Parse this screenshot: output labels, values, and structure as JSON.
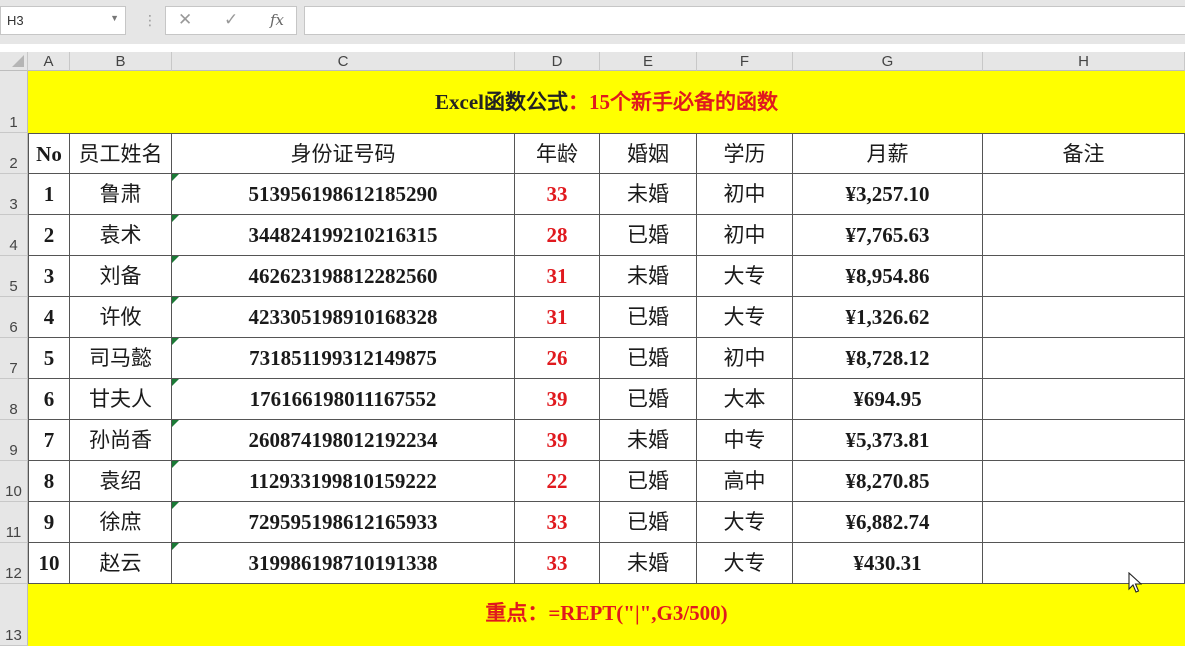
{
  "namebox": {
    "value": "H3"
  },
  "formula_bar": {
    "cancel_icon": "✕",
    "enter_icon": "✓",
    "fx_label": "fx",
    "value": ""
  },
  "columns": [
    "A",
    "B",
    "C",
    "D",
    "E",
    "F",
    "G",
    "H"
  ],
  "rows": [
    "1",
    "2",
    "3",
    "4",
    "5",
    "6",
    "7",
    "8",
    "9",
    "10",
    "11",
    "12",
    "13"
  ],
  "title": {
    "black": "Excel函数公式",
    "red": "：15个新手必备的函数"
  },
  "headers": [
    "No",
    "员工姓名",
    "身份证号码",
    "年龄",
    "婚姻",
    "学历",
    "月薪",
    "备注"
  ],
  "records": [
    [
      "1",
      "鲁肃",
      "513956198612185290",
      "33",
      "未婚",
      "初中",
      "¥3,257.10",
      ""
    ],
    [
      "2",
      "袁术",
      "344824199210216315",
      "28",
      "已婚",
      "初中",
      "¥7,765.63",
      ""
    ],
    [
      "3",
      "刘备",
      "462623198812282560",
      "31",
      "未婚",
      "大专",
      "¥8,954.86",
      ""
    ],
    [
      "4",
      "许攸",
      "423305198910168328",
      "31",
      "已婚",
      "大专",
      "¥1,326.62",
      ""
    ],
    [
      "5",
      "司马懿",
      "731851199312149875",
      "26",
      "已婚",
      "初中",
      "¥8,728.12",
      ""
    ],
    [
      "6",
      "甘夫人",
      "176166198011167552",
      "39",
      "已婚",
      "大本",
      "¥694.95",
      ""
    ],
    [
      "7",
      "孙尚香",
      "260874198012192234",
      "39",
      "未婚",
      "中专",
      "¥5,373.81",
      ""
    ],
    [
      "8",
      "袁绍",
      "112933199810159222",
      "22",
      "已婚",
      "高中",
      "¥8,270.85",
      ""
    ],
    [
      "9",
      "徐庶",
      "729595198612165933",
      "33",
      "已婚",
      "大专",
      "¥6,882.74",
      ""
    ],
    [
      "10",
      "赵云",
      "319986198710191338",
      "33",
      "未婚",
      "大专",
      "¥430.31",
      ""
    ]
  ],
  "note": {
    "black": "重点：",
    "red": "=REPT(\"|\",G3/500)"
  },
  "colors": {
    "band": "#ffff00",
    "accent_red": "#e0191e",
    "header_gray": "#e6e6e6"
  }
}
